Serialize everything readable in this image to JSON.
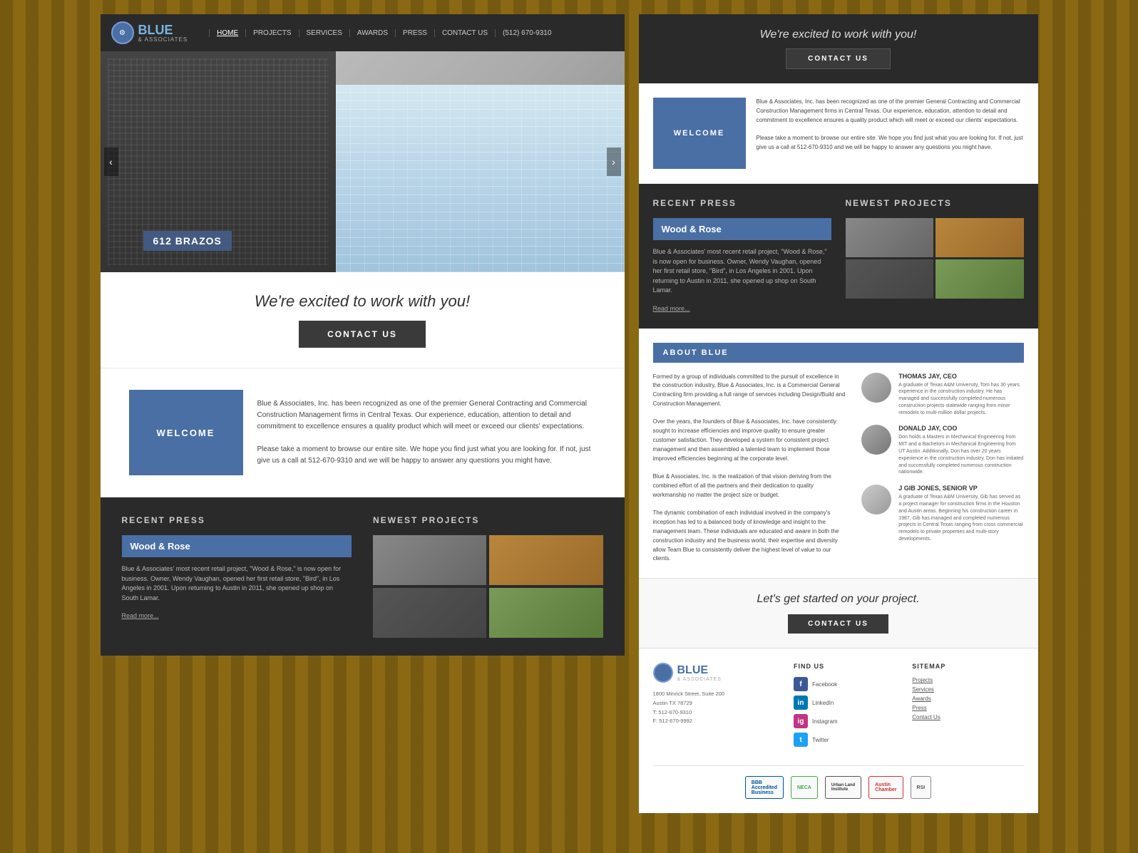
{
  "brand": {
    "name": "BLUE",
    "subtitle": "& ASSOCIATES",
    "logo_symbol": "⚙"
  },
  "nav": {
    "links": [
      "HOME",
      "PROJECTS",
      "SERVICES",
      "AWARDS",
      "PRESS",
      "CONTACT US"
    ],
    "phone": "(512) 670-9310",
    "home_active": true
  },
  "hero": {
    "label": "612 BRAZOS",
    "arrow_left": "‹",
    "arrow_right": "›"
  },
  "left_cta": {
    "title": "We're excited to work with you!",
    "button": "CONTACT US"
  },
  "welcome": {
    "box_label": "WELCOME",
    "body1": "Blue & Associates, Inc. has been recognized as one of the premier General Contracting and Commercial Construction Management firms in Central Texas. Our experience, education, attention to detail and commitment to excellence ensures a quality product which will meet or exceed our clients' expectations.",
    "body2": "Please take a moment to browse our entire site. We hope you find just what you are looking for. If not, just give us a call at 512-670-9310 and we will be happy to answer any questions you might have."
  },
  "recent_press": {
    "title": "RECENT PRESS",
    "item": "Wood & Rose",
    "body": "Blue & Associates' most recent retail project, \"Wood & Rose,\" is now open for business. Owner, Wendy Vaughan, opened her first retail store, \"Bird\", in Los Angeles in 2001. Upon returning to Austin in 2011, she opened up shop on South Lamar.",
    "read_more": "Read more..."
  },
  "newest_projects": {
    "title": "NEWEST PROJECTS"
  },
  "right": {
    "top_cta_title": "We're excited to work with you!",
    "top_cta_button": "CONTACT US"
  },
  "about": {
    "title": "ABOUT BLUE",
    "body1": "Formed by a group of individuals committed to the pursuit of excellence in the construction industry, Blue & Associates, Inc. is a Commercial General Contracting firm providing a full range of services including Design/Build and Construction Management.",
    "body2": "Over the years, the founders of Blue & Associates, Inc. have consistently sought to increase efficiencies and improve quality to ensure greater customer satisfaction. They developed a system for consistent project management and then assembled a talented team to implement those improved efficiencies beginning at the corporate level.",
    "body3": "Blue & Associates, Inc. is the realization of that vision deriving from the combined effort of all the partners and their dedication to quality workmanship no matter the project size or budget.",
    "body4": "The dynamic combination of each individual involved in the company's inception has led to a balanced body of knowledge and insight to the management team. These individuals are educated and aware in both the construction industry and the business world, their expertise and diversity allow Team Blue to consistently deliver the highest level of value to our clients."
  },
  "team": [
    {
      "name": "THOMAS JAY, CEO",
      "bio": "A graduate of Texas A&M University, Tom has 30 years experience in the construction industry. He has managed and successfully completed numerous construction projects statewide ranging from minor remodels to multi-million dollar projects."
    },
    {
      "name": "DONALD JAY, COO",
      "bio": "Don holds a Masters in Mechanical Engineering from MIT and a Bachelors in Mechanical Engineering from UT Austin. Additionally, Don has over 20 years experience in the construction industry. Don has initiated and successfully completed numerous construction nationwide."
    },
    {
      "name": "J GIB JONES, SENIOR VP",
      "bio": "A graduate of Texas A&M University, Gib has served as a project manager for construction firms in the Houston and Austin areas. Beginning his construction career in 1987, Gib has managed and completed numerous projects in Central Texas ranging from cross commercial remodels to private properties and multi-story developments."
    }
  ],
  "cta_bottom": {
    "title": "Let's get started on your project.",
    "button": "CONTACT US"
  },
  "footer": {
    "address_line1": "1800 Minrick Street, Suite 200",
    "address_line2": "Austin TX 78729",
    "phone": "T: 512-670-9310",
    "fax": "F: 512-670-9992",
    "find_us_title": "FIND US",
    "sitemap_title": "SITEMAP",
    "social": [
      {
        "name": "Facebook",
        "icon": "f",
        "class": "social-icon-fb"
      },
      {
        "name": "LinkedIn",
        "icon": "in",
        "class": "social-icon-li"
      },
      {
        "name": "Instagram",
        "icon": "ig",
        "class": "social-icon-ig"
      },
      {
        "name": "Twitter",
        "icon": "t",
        "class": "social-icon-tw"
      }
    ],
    "sitemap_links": [
      "Projects",
      "Services",
      "Awards",
      "Press",
      "Contact Us"
    ],
    "partners": [
      "BBB Accredited Business",
      "NECA",
      "Urban Land Institute",
      "Austin Chamber",
      "RSI"
    ]
  }
}
